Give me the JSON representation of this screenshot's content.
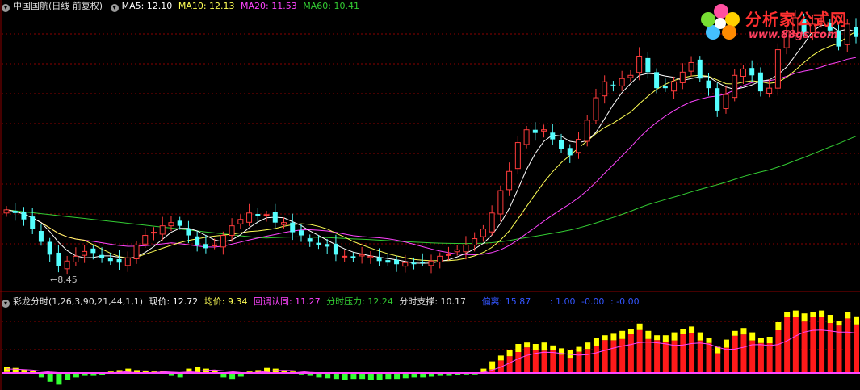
{
  "main_header": {
    "title": "中国国航(日线 前复权)",
    "ma5": "MA5: 12.10",
    "ma10": "MA10: 12.13",
    "ma20": "MA20: 11.53",
    "ma60": "MA60: 10.41"
  },
  "indicator_header": {
    "formula": "彩龙分时(1,26,3,90,21,44,1,1)",
    "price": "现价: 12.72",
    "avg": "均价: 9.34",
    "pullback": "回调认同: 11.27",
    "pressure": "分时压力: 12.24",
    "support": "分时支撑: 10.17",
    "deviation": "偏离: 15.87",
    "v1": ": 1.00",
    "v2": "-0.00",
    "v3": ": -0.00"
  },
  "low_label": "←8.45",
  "logo": {
    "title": "分析家公式网",
    "url": "www.88gs.com"
  },
  "colors": {
    "up": "#ff3c3c",
    "down": "#54ffff",
    "ma5": "#ffffff",
    "ma10": "#ffff55",
    "ma20": "#ff44ff",
    "ma60": "#33cc33",
    "grid": "#8b0000",
    "bar_yellow": "#ffff00",
    "bar_red": "#ff1a1a",
    "bar_green": "#33ff33"
  },
  "chart_data": [
    {
      "type": "candlestick",
      "title": "中国国航(日线 前复权)",
      "price_range": [
        8.0,
        16.6
      ],
      "closes": [
        10.4,
        10.3,
        10.1,
        9.8,
        9.4,
        9.0,
        8.65,
        8.8,
        8.95,
        9.1,
        9.05,
        8.9,
        8.8,
        8.75,
        8.9,
        9.3,
        9.6,
        9.7,
        9.9,
        10.0,
        9.9,
        9.6,
        9.3,
        9.2,
        9.3,
        9.6,
        9.9,
        10.1,
        10.3,
        10.2,
        10.25,
        10.0,
        10.0,
        9.7,
        9.6,
        9.4,
        9.3,
        9.25,
        9.0,
        8.95,
        8.9,
        9.0,
        8.95,
        8.8,
        8.75,
        8.7,
        8.75,
        8.7,
        8.75,
        8.8,
        8.95,
        9.0,
        9.15,
        9.3,
        9.5,
        9.8,
        10.3,
        11.0,
        11.6,
        12.5,
        12.9,
        12.8,
        12.9,
        12.6,
        12.3,
        12.1,
        12.6,
        13.2,
        13.9,
        14.4,
        14.3,
        14.5,
        14.6,
        15.2,
        14.7,
        14.2,
        14.2,
        14.4,
        14.7,
        15.0,
        14.5,
        14.2,
        13.5,
        14.0,
        14.6,
        14.8,
        14.6,
        14.1,
        14.2,
        15.4,
        16.0,
        16.4,
        15.9,
        16.2,
        16.3,
        16.0,
        15.5,
        16.2,
        15.8
      ],
      "ma5_last": 12.1,
      "ma10_last": 12.13,
      "ma20_last": 11.53,
      "ma60_last": 10.41,
      "low_marker": 8.45
    },
    {
      "type": "bar",
      "title": "彩龙分时(1,26,3,90,21,44,1,1)",
      "description_values": {
        "price": 12.72,
        "avg": 9.34,
        "pullback": 11.27,
        "pressure": 12.24,
        "support": 10.17,
        "deviation": 15.87
      },
      "values": [
        0.4,
        0.35,
        0.25,
        0.15,
        -0.3,
        -0.6,
        -0.8,
        -0.5,
        -0.3,
        -0.2,
        -0.2,
        -0.15,
        0.1,
        0.2,
        0.3,
        0.2,
        0.15,
        0.1,
        0.1,
        -0.2,
        -0.3,
        0.3,
        0.4,
        0.3,
        0.2,
        -0.3,
        -0.4,
        -0.25,
        0.1,
        0.2,
        0.35,
        0.3,
        0.2,
        0.1,
        -0.1,
        -0.2,
        -0.3,
        -0.35,
        -0.4,
        -0.45,
        -0.4,
        -0.4,
        -0.45,
        -0.45,
        -0.4,
        -0.4,
        -0.35,
        -0.3,
        -0.3,
        -0.25,
        -0.2,
        -0.2,
        -0.15,
        -0.1,
        -0.1,
        0.3,
        0.8,
        1.2,
        1.6,
        2.0,
        2.1,
        2.0,
        2.1,
        1.9,
        1.7,
        1.6,
        1.8,
        2.1,
        2.4,
        2.6,
        2.7,
        2.9,
        3.0,
        3.4,
        2.9,
        2.6,
        2.6,
        2.8,
        3.0,
        3.2,
        2.8,
        2.4,
        1.8,
        2.3,
        2.9,
        3.1,
        2.8,
        2.4,
        2.5,
        3.5,
        4.2,
        4.3,
        4.1,
        4.2,
        4.3,
        4.0,
        3.6,
        4.2,
        3.9
      ]
    }
  ]
}
